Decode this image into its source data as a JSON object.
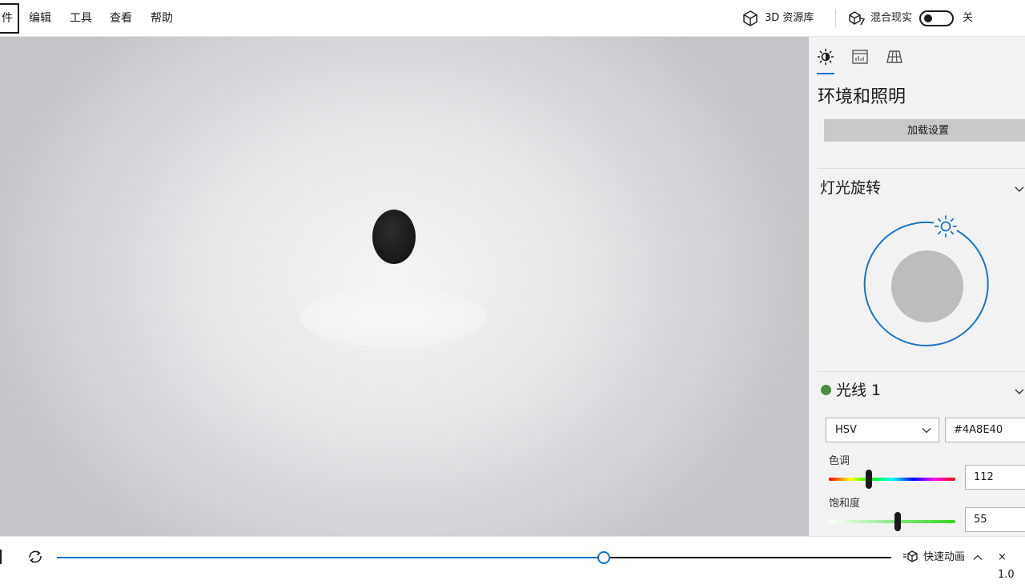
{
  "menu": {
    "file": "件",
    "edit": "编辑",
    "tools": "工具",
    "view": "查看",
    "help": "帮助"
  },
  "toolbar": {
    "library_label": "3D 资源库",
    "mixed_reality_label": "混合现实",
    "toggle_state_label": "关"
  },
  "panel": {
    "tabs": [
      {
        "icon": "sun-icon"
      },
      {
        "icon": "stats-icon"
      },
      {
        "icon": "grid-icon"
      }
    ],
    "title": "环境和照明",
    "load_button": "加载设置",
    "light_rotation": {
      "header": "灯光旋转",
      "accent": "#1a73c9"
    },
    "light": {
      "name": "光线 1",
      "color": "#4a8e40",
      "mode": "HSV",
      "hex": "#4A8E40",
      "hue_label": "色调",
      "hue": "112",
      "saturation_label": "饱和度",
      "saturation": "55"
    }
  },
  "timeline": {
    "progress": 0.655,
    "quick_animation_label": "快速动画",
    "speed_label": "× 1.0"
  }
}
